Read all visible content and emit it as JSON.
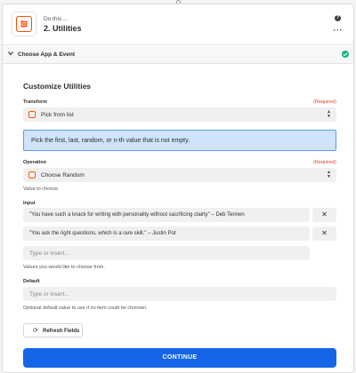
{
  "header": {
    "subtitle": "Do this ...",
    "title": "2. Utilities",
    "help_glyph": "?",
    "more_glyph": "···"
  },
  "section": {
    "label": "Choose App & Event",
    "status": "complete"
  },
  "form": {
    "heading": "Customize Utilities",
    "transform": {
      "label": "Transform",
      "required": "(Required)",
      "value": "Pick from list"
    },
    "info_text": "Pick the first, last, random, or n-th value that is not empty.",
    "operation": {
      "label": "Operation",
      "required": "(Required)",
      "value": "Choose Random",
      "help": "Value to choose."
    },
    "input": {
      "label": "Input",
      "items": [
        "\"You have such a knack for writing with personality without sacrificing clairty\" – Deb Tennen",
        "\"You ask the right questions, which is a rare skill.\" – Justin Pot"
      ],
      "remove_glyph": "✕",
      "placeholder": "Type or insert...",
      "help": "Values you would like to choose from."
    },
    "default": {
      "label": "Default",
      "placeholder": "Type or insert...",
      "help": "Optional default value to use if no item could be choosen."
    },
    "refresh_label": "Refresh Fields",
    "continue_label": "CONTINUE"
  },
  "colors": {
    "accent": "#1466e6",
    "brand": "#ff4f00",
    "required": "#e0412b",
    "success": "#13b67a",
    "info_bg": "#cfe3fb"
  }
}
